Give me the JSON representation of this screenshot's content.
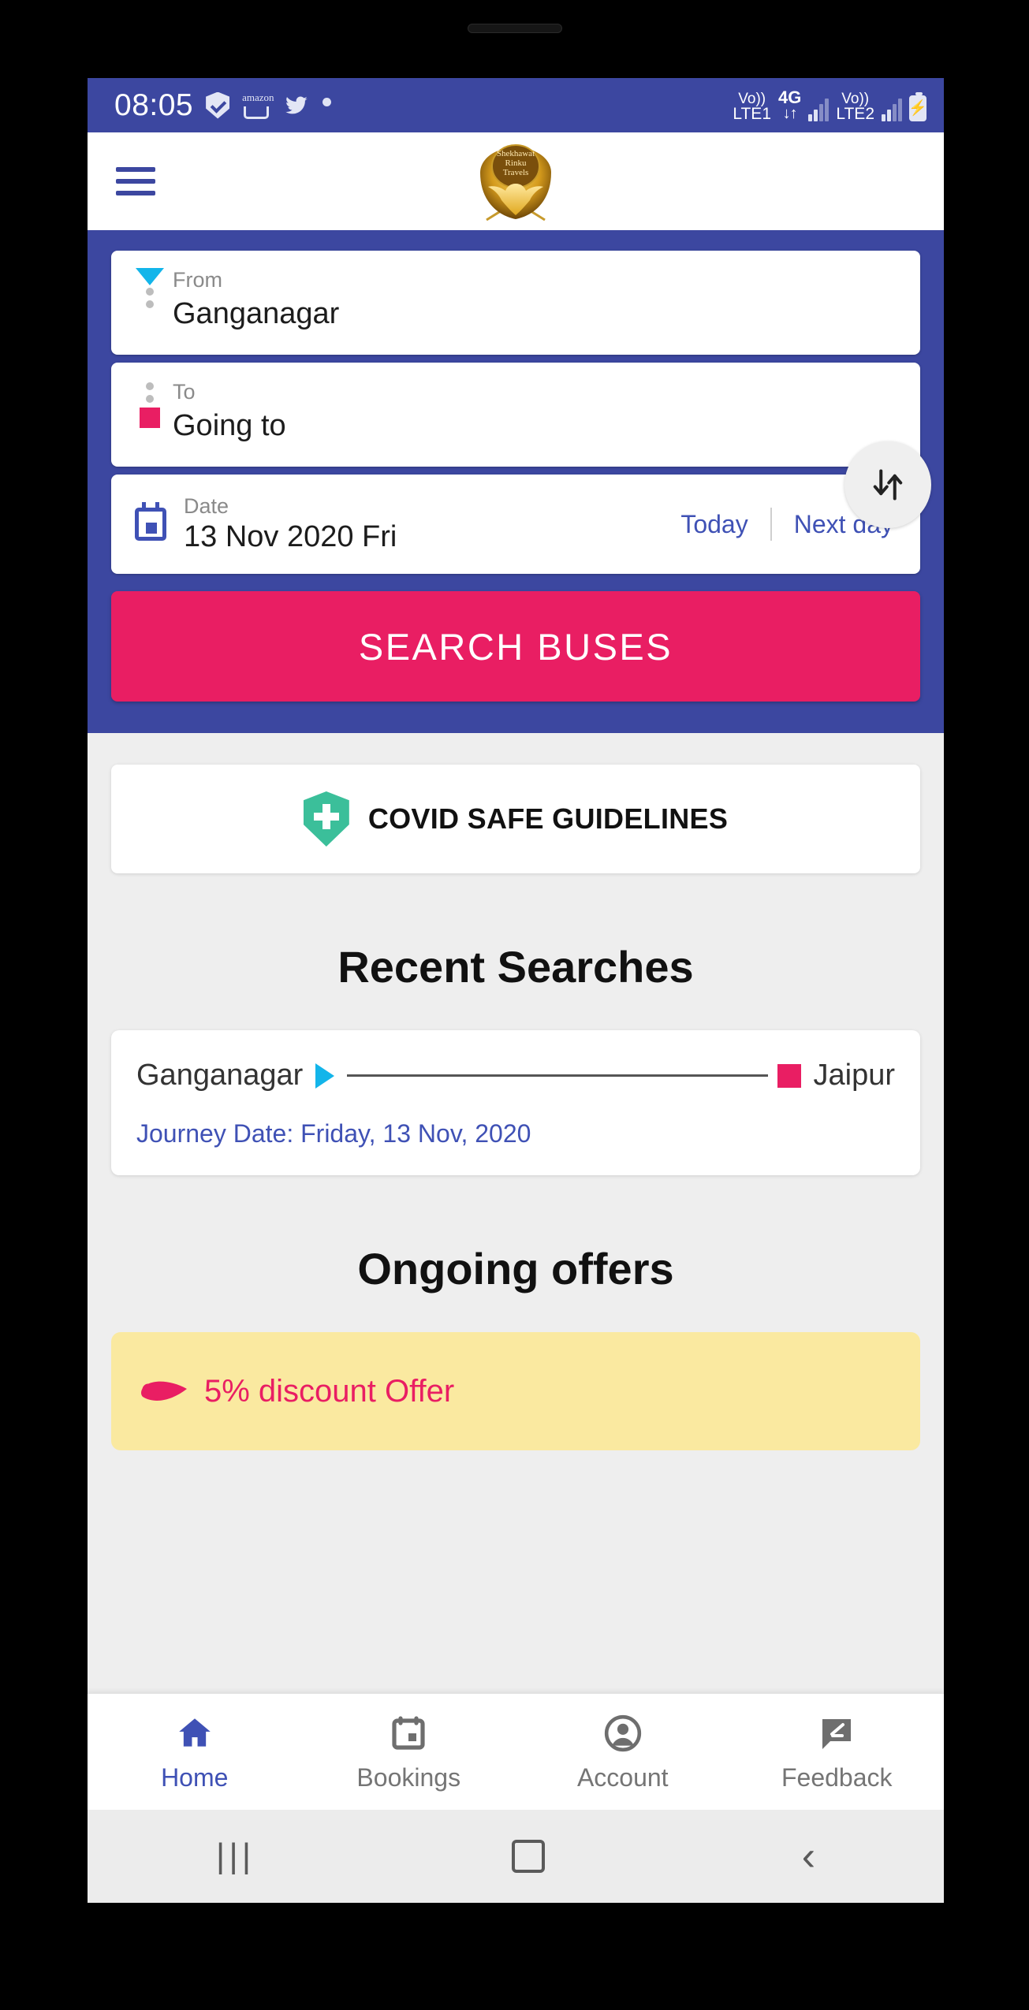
{
  "status_bar": {
    "time": "08:05",
    "left_icons": [
      "shield-check-icon",
      "amazon-icon",
      "twitter-icon",
      "dot-icon"
    ],
    "volte1_top": "Vo))",
    "volte1_bottom": "LTE1",
    "network_type": "4G",
    "network_arrows": "↓↑",
    "volte2_top": "Vo))",
    "volte2_bottom": "LTE2",
    "battery": "⚡"
  },
  "app_bar": {
    "menu_icon": "hamburger-icon",
    "logo_line1": "Shekhawat",
    "logo_line2": "Rinku",
    "logo_line3": "Travels"
  },
  "search_form": {
    "from": {
      "label": "From",
      "value": "Ganganagar",
      "marker": "triangle-down-cyan"
    },
    "to": {
      "label": "To",
      "value": "Going to",
      "marker": "square-pink"
    },
    "swap_icon": "swap-vertical-icon",
    "date": {
      "label": "Date",
      "value": "13 Nov 2020 Fri",
      "today_label": "Today",
      "next_day_label": "Next day"
    },
    "search_button": "SEARCH BUSES"
  },
  "covid": {
    "label": "COVID SAFE GUIDELINES",
    "icon": "shield-plus-icon"
  },
  "recent_searches": {
    "title": "Recent Searches",
    "items": [
      {
        "from": "Ganganagar",
        "to": "Jaipur",
        "journey_date": "Journey Date: Friday, 13 Nov, 2020"
      }
    ]
  },
  "offers": {
    "title": "Ongoing offers",
    "items": [
      {
        "text": "5% discount Offer",
        "icon": "tag-icon"
      }
    ]
  },
  "bottom_nav": {
    "items": [
      {
        "label": "Home",
        "icon": "home-icon",
        "active": true
      },
      {
        "label": "Bookings",
        "icon": "calendar-icon",
        "active": false
      },
      {
        "label": "Account",
        "icon": "account-circle-icon",
        "active": false
      },
      {
        "label": "Feedback",
        "icon": "feedback-icon",
        "active": false
      }
    ]
  },
  "system_nav": {
    "recents": "|||",
    "home": "home-square-icon",
    "back": "‹"
  },
  "colors": {
    "primary": "#3c47a0",
    "accent_pink": "#e91e63",
    "cyan": "#13b5ea",
    "link_blue": "#3f51b5",
    "offer_bg": "#fae9a0",
    "covid_green": "#3bbf9a"
  }
}
